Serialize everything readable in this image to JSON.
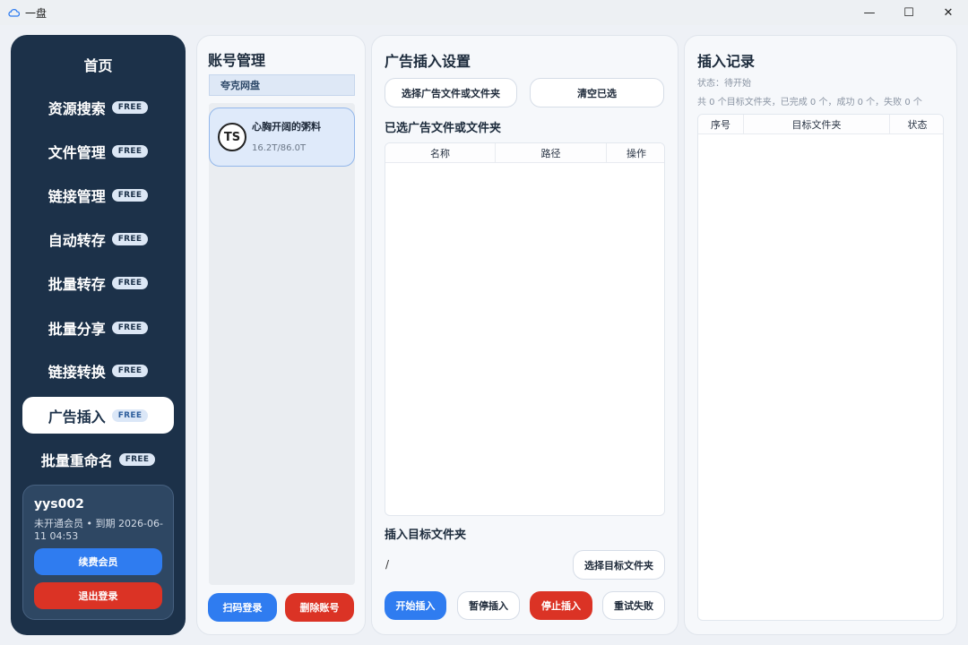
{
  "window": {
    "title": "一盘",
    "minimize": "—",
    "maximize": "☐",
    "close": "✕"
  },
  "sidebar": {
    "home": "首页",
    "items": [
      {
        "label": "资源搜索",
        "badge": "FREE"
      },
      {
        "label": "文件管理",
        "badge": "FREE"
      },
      {
        "label": "链接管理",
        "badge": "FREE"
      },
      {
        "label": "自动转存",
        "badge": "FREE"
      },
      {
        "label": "批量转存",
        "badge": "FREE"
      },
      {
        "label": "批量分享",
        "badge": "FREE"
      },
      {
        "label": "链接转换",
        "badge": "FREE"
      },
      {
        "label": "广告插入",
        "badge": "FREE",
        "active": true
      },
      {
        "label": "批量重命名",
        "badge": "FREE"
      }
    ],
    "user": {
      "name": "yys002",
      "info": "未开通会员 • 到期 2026-06-11 04:53",
      "renew": "续费会员",
      "logout": "退出登录"
    }
  },
  "accounts": {
    "title": "账号管理",
    "tab": "夸克网盘",
    "card": {
      "avatar": "TS",
      "name": "心胸开阔的粥料",
      "size": "16.2T/86.0T"
    },
    "scan_login": "扫码登录",
    "delete": "删除账号"
  },
  "ad_settings": {
    "title": "广告插入设置",
    "select_files": "选择广告文件或文件夹",
    "clear": "清空已选",
    "selected_title": "已选广告文件或文件夹",
    "columns": [
      "名称",
      "路径",
      "操作"
    ],
    "target_title": "插入目标文件夹",
    "target_path": "/",
    "select_target": "选择目标文件夹",
    "start": "开始插入",
    "pause": "暂停插入",
    "stop": "停止插入",
    "retry": "重试失败"
  },
  "log": {
    "title": "插入记录",
    "status": "状态：待开始",
    "summary": "共 0 个目标文件夹，已完成 0 个，成功 0 个，失败 0 个",
    "columns": [
      "序号",
      "目标文件夹",
      "状态"
    ]
  },
  "colors": {
    "sidebar_bg": "#1c3149",
    "primary": "#2f7cf0",
    "danger": "#db3325"
  }
}
